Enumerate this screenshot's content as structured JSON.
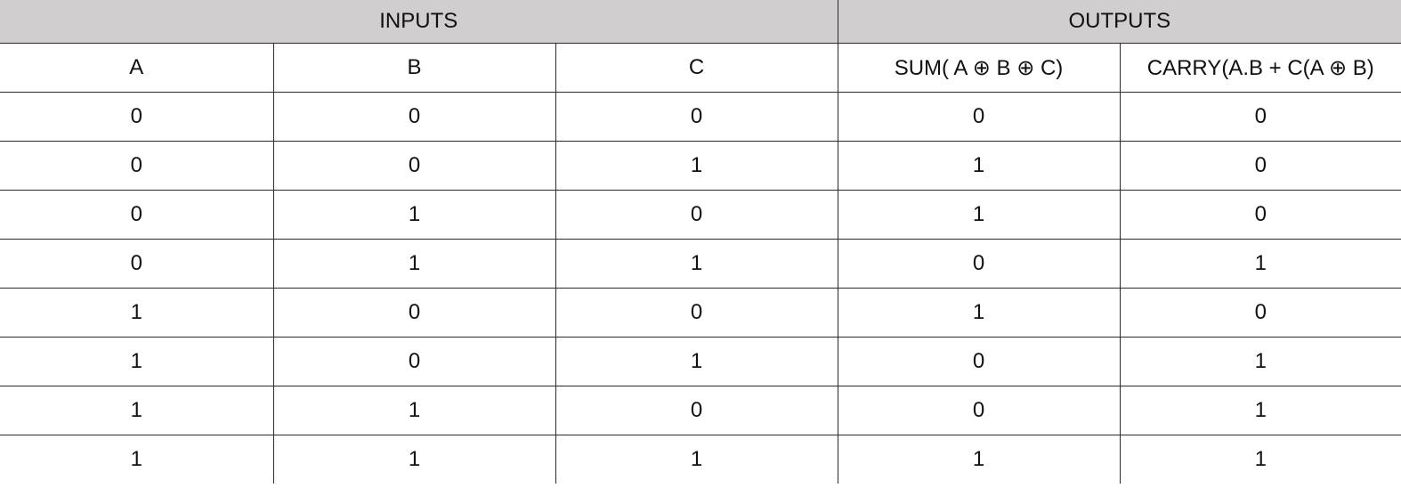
{
  "table": {
    "groups": {
      "inputs": "INPUTS",
      "outputs": "OUTPUTS"
    },
    "columns": [
      "A",
      "B",
      "C",
      "SUM( A ⊕ B ⊕ C)",
      "CARRY(A.B + C(A ⊕ B)"
    ],
    "rows": [
      [
        "0",
        "0",
        "0",
        "0",
        "0"
      ],
      [
        "0",
        "0",
        "1",
        "1",
        "0"
      ],
      [
        "0",
        "1",
        "0",
        "1",
        "0"
      ],
      [
        "0",
        "1",
        "1",
        "0",
        "1"
      ],
      [
        "1",
        "0",
        "0",
        "1",
        "0"
      ],
      [
        "1",
        "0",
        "1",
        "0",
        "1"
      ],
      [
        "1",
        "1",
        "0",
        "0",
        "1"
      ],
      [
        "1",
        "1",
        "1",
        "1",
        "1"
      ]
    ]
  }
}
